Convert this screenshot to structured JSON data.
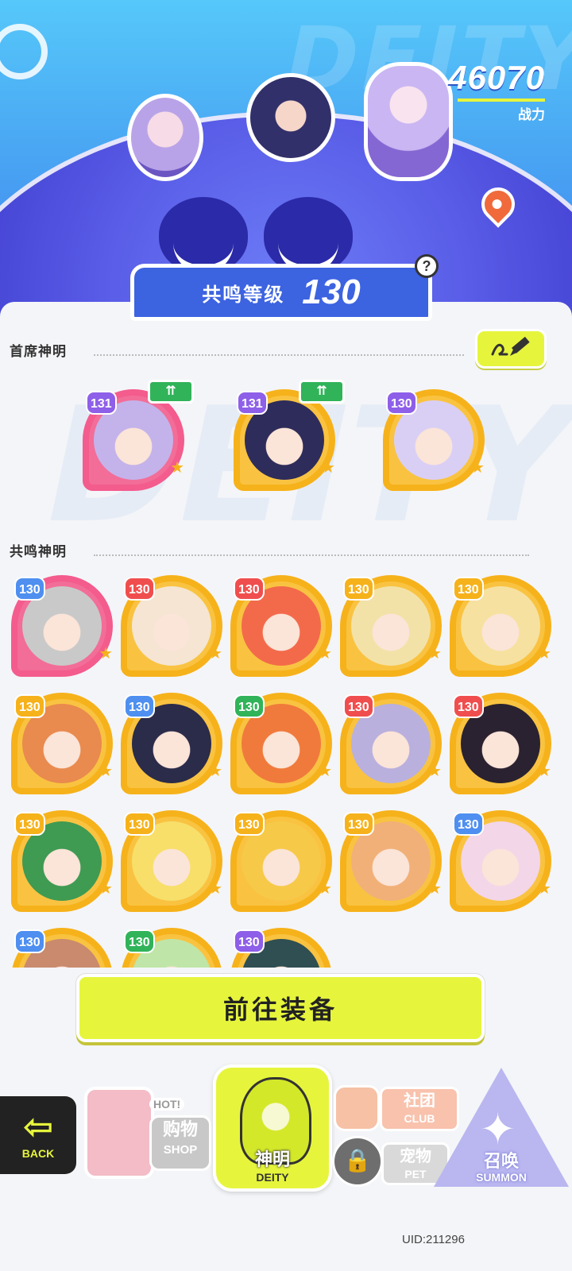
{
  "header": {
    "power_value": "46070",
    "power_label": "战力",
    "resonance_label": "共鸣等级",
    "resonance_level": "130",
    "help_icon": "?",
    "bg_word": "DEITY"
  },
  "first_deities": {
    "title": "首席神明",
    "items": [
      {
        "level": "131",
        "frame": "pink",
        "hair": "#c4b3ea",
        "upgrade": true
      },
      {
        "level": "131",
        "frame": "gold",
        "hair": "#2e2c5a",
        "upgrade": true
      },
      {
        "level": "130",
        "frame": "gold",
        "hair": "#d9cff5",
        "upgrade": false
      }
    ],
    "upgrade_label": "⇈"
  },
  "resonance_deities": {
    "title": "共鸣神明",
    "items": [
      {
        "level": "130",
        "frame": "pink",
        "lvbg": "#4e8ff0",
        "hair": "#c9c9c9"
      },
      {
        "level": "130",
        "frame": "gold",
        "lvbg": "#f04e4e",
        "hair": "#f5e5d2"
      },
      {
        "level": "130",
        "frame": "gold",
        "lvbg": "#f04e4e",
        "hair": "#f36a4a"
      },
      {
        "level": "130",
        "frame": "gold",
        "lvbg": "#f6b21b",
        "hair": "#f3e2a8"
      },
      {
        "level": "130",
        "frame": "gold",
        "lvbg": "#f6b21b",
        "hair": "#f6e1a0"
      },
      {
        "level": "130",
        "frame": "gold",
        "lvbg": "#f6b21b",
        "hair": "#e98a4e"
      },
      {
        "level": "130",
        "frame": "gold",
        "lvbg": "#4e8ff0",
        "hair": "#2b2b4a"
      },
      {
        "level": "130",
        "frame": "gold",
        "lvbg": "#31b35a",
        "hair": "#f07a3c"
      },
      {
        "level": "130",
        "frame": "gold",
        "lvbg": "#f04e4e",
        "hair": "#b9b0de"
      },
      {
        "level": "130",
        "frame": "gold",
        "lvbg": "#f04e4e",
        "hair": "#2a2230"
      },
      {
        "level": "130",
        "frame": "gold",
        "lvbg": "#f6b21b",
        "hair": "#3f9a52"
      },
      {
        "level": "130",
        "frame": "gold",
        "lvbg": "#f6b21b",
        "hair": "#f7df6a"
      },
      {
        "level": "130",
        "frame": "gold",
        "lvbg": "#f6b21b",
        "hair": "#f6c948"
      },
      {
        "level": "130",
        "frame": "gold",
        "lvbg": "#f6b21b",
        "hair": "#f1b078"
      },
      {
        "level": "130",
        "frame": "gold",
        "lvbg": "#4e8ff0",
        "hair": "#f3d6e8"
      },
      {
        "level": "130",
        "frame": "gold",
        "lvbg": "#4e8ff0",
        "hair": "#c98a6e"
      },
      {
        "level": "130",
        "frame": "gold",
        "lvbg": "#31b35a",
        "hair": "#bfe6a8"
      },
      {
        "level": "130",
        "frame": "gold",
        "lvbg": "#8e5fe8",
        "hair": "#2f4f52"
      }
    ]
  },
  "equip_button": "前往装备",
  "nav": {
    "back_label": "BACK",
    "shop_hot": "HOT!",
    "shop_cn": "购物",
    "shop_en": "SHOP",
    "deity_cn": "神明",
    "deity_en": "DEITY",
    "club_cn": "社团",
    "club_en": "CLUB",
    "pet_cn": "宠物",
    "pet_en": "PET",
    "summon_cn": "召唤",
    "summon_en": "SUMMON"
  },
  "uid": "UID:211296"
}
